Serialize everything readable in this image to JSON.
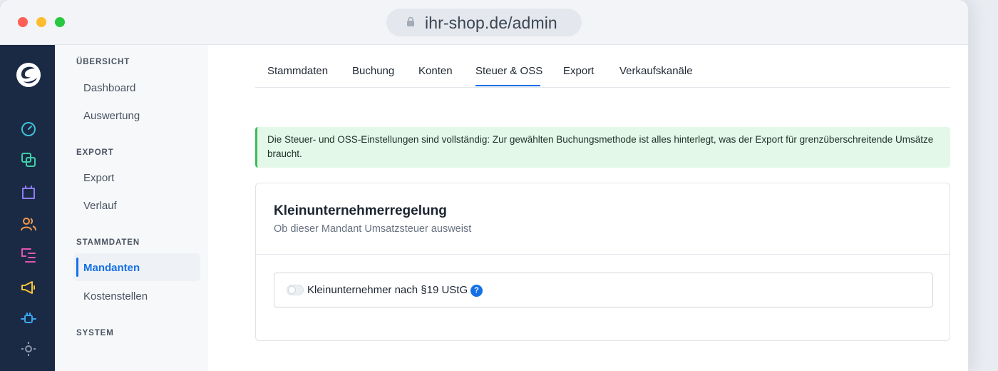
{
  "browser": {
    "url": "ihr-shop.de/admin"
  },
  "rail": {
    "icons": [
      "shopware-logo-icon",
      "dashboard-gauge-icon",
      "copy-icon",
      "shopping-bag-icon",
      "users-icon",
      "list-icon",
      "megaphone-icon",
      "plug-icon",
      "settings-gear-icon"
    ],
    "colors": {
      "background": "#1b2a44",
      "gauge": "#3ec1d9",
      "copy": "#3ed1a8",
      "bag": "#8f7cf6",
      "users": "#f39a4b",
      "list": "#e255b0",
      "megaphone": "#f6c33a",
      "plug": "#3aa7f5"
    }
  },
  "nav": {
    "sections": [
      {
        "title": "ÜBERSICHT",
        "items": [
          "Dashboard",
          "Auswertung"
        ]
      },
      {
        "title": "EXPORT",
        "items": [
          "Export",
          "Verlauf"
        ]
      },
      {
        "title": "STAMMDATEN",
        "items": [
          "Mandanten",
          "Kostenstellen"
        ]
      },
      {
        "title": "SYSTEM",
        "items": []
      }
    ],
    "active_item": "Mandanten"
  },
  "tabs": [
    "Stammdaten",
    "Buchung",
    "Konten",
    "Steuer & OSS",
    "Export",
    "Verkaufskanäle"
  ],
  "active_tab": "Steuer & OSS",
  "alert": {
    "text": "Die Steuer- und OSS-Einstellungen sind vollständig: Zur gewählten Buchungsmethode ist alles hinterlegt, was der Export für grenzüberschreitende Umsätze braucht.",
    "color": "#3dbb5c"
  },
  "card": {
    "title": "Kleinunternehmerregelung",
    "subtitle": "Ob dieser Mandant Umsatzsteuer ausweist",
    "toggle_label": "Kleinunternehmer nach §19 UStG",
    "toggle_on": false,
    "help_glyph": "?"
  },
  "accent": "#1570e6"
}
